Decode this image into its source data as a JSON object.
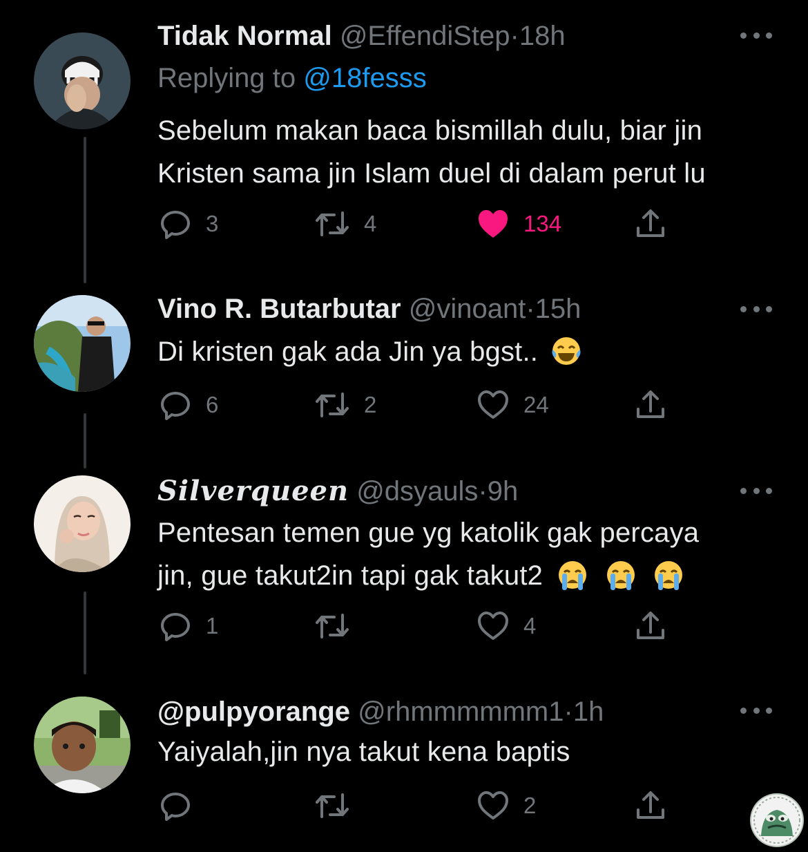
{
  "tweets": [
    {
      "name": "Tidak Normal",
      "handle": "@EffendiStep",
      "dot": "·",
      "time": "18h",
      "replying_prefix": "Replying to",
      "replying_to": "@18fesss",
      "text_lines": [
        "Sebelum makan baca bismillah dulu, biar jin",
        "Kristen sama jin Islam duel di dalam perut lu"
      ],
      "replies": "3",
      "retweets": "4",
      "likes": "134",
      "liked": true
    },
    {
      "name": "Vino R. Butarbutar",
      "handle": "@vinoant",
      "dot": "·",
      "time": "15h",
      "text_lines": [
        "Di kristen gak ada Jin ya bgst.."
      ],
      "emoji": "face-with-tears-of-joy",
      "replies": "6",
      "retweets": "2",
      "likes": "24",
      "liked": false
    },
    {
      "name": "Silverqueen",
      "handle": "@dsyauls",
      "dot": "·",
      "time": "9h",
      "text_lines": [
        "Pentesan temen gue yg katolik gak percaya",
        "jin, gue takut2in tapi gak takut2"
      ],
      "emoji": "loudly-crying-face",
      "replies": "1",
      "retweets": "",
      "likes": "4",
      "liked": false
    },
    {
      "name": "@pulpyorange",
      "handle": "@rhmmmmmm1",
      "dot": "·",
      "time": "1h",
      "text_lines": [
        "Yaiyalah,jin nya takut kena baptis"
      ],
      "replies": "",
      "retweets": "",
      "likes": "2",
      "liked": false
    }
  ],
  "colors": {
    "background": "#000000",
    "text": "#e7e9ea",
    "secondary": "#71767b",
    "link": "#1d9bf0",
    "like": "#f91880"
  },
  "icons": [
    "reply-icon",
    "retweet-icon",
    "like-icon",
    "share-icon",
    "more-icon"
  ]
}
